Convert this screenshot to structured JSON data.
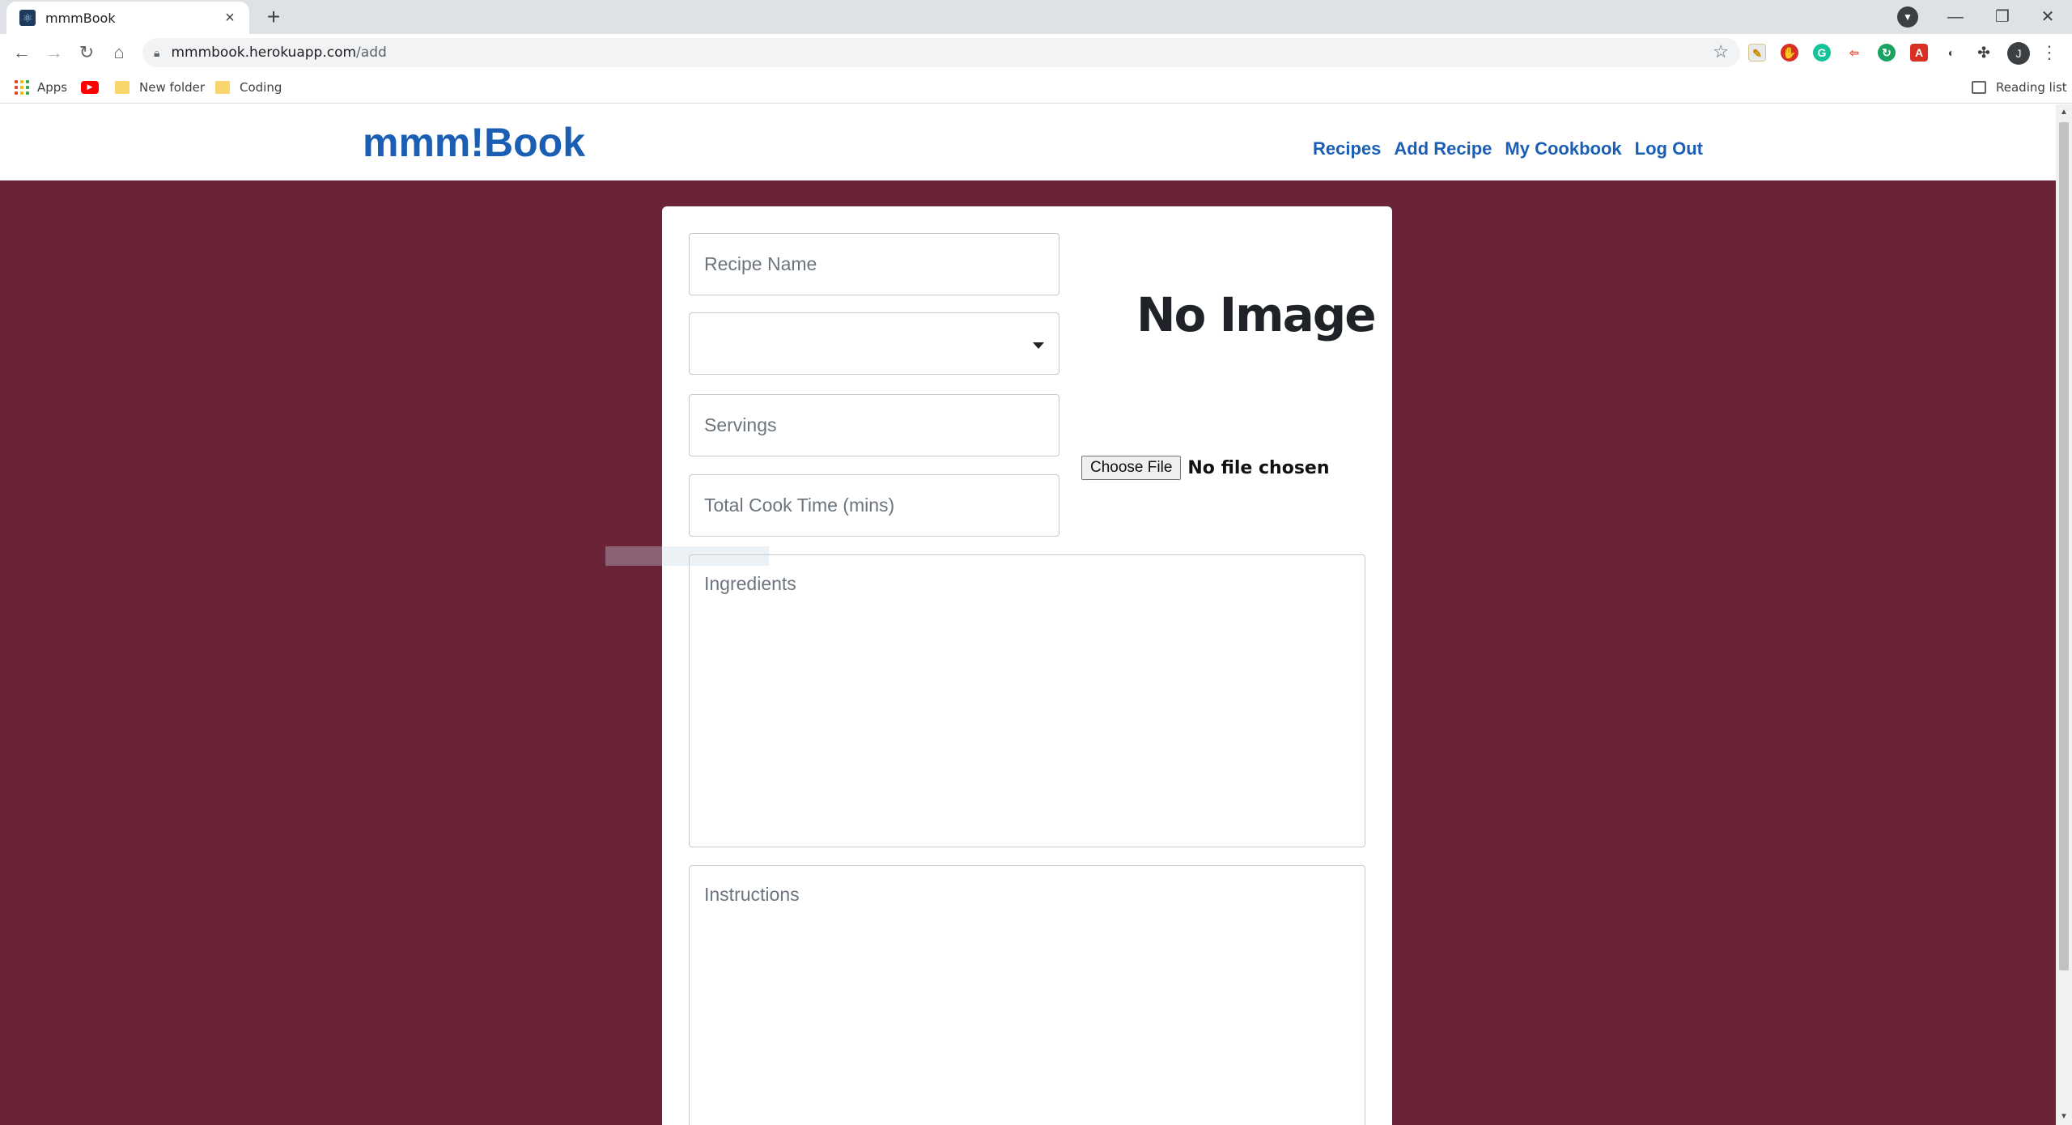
{
  "browser": {
    "tab_title": "mmmBook",
    "tab_close": "×",
    "new_tab": "+",
    "url_host": "mmmbook.herokuapp.com",
    "url_path": "/add",
    "profile_initial": "J",
    "window_controls": {
      "minimize": "—",
      "restore": "❐",
      "close": "✕"
    }
  },
  "bookmarks": {
    "apps_label": "Apps",
    "items": [
      "New folder",
      "Coding"
    ],
    "reading_list": "Reading list"
  },
  "site": {
    "brand": "mmm!Book",
    "nav": [
      "Recipes",
      "Add Recipe",
      "My Cookbook",
      "Log Out"
    ]
  },
  "form": {
    "recipe_name_placeholder": "Recipe Name",
    "category_value": "",
    "servings_placeholder": "Servings",
    "cook_time_placeholder": "Total Cook Time (mins)",
    "ingredients_placeholder": "Ingredients",
    "instructions_placeholder": "Instructions",
    "image_placeholder_text": "No Image",
    "file_button": "Choose File",
    "file_status": "No file chosen"
  },
  "colors": {
    "page_background": "#6b2437",
    "brand_blue": "#1a5fb4"
  }
}
